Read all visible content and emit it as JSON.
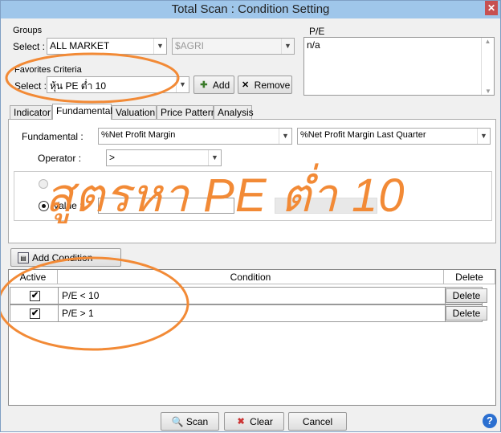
{
  "window": {
    "title": "Total Scan : Condition Setting"
  },
  "groups": {
    "label": "Groups",
    "select_label": "Select :",
    "select_value": "ALL MARKET",
    "secondary_value": "$AGRI"
  },
  "pe_box": {
    "label": "P/E",
    "value": "n/a"
  },
  "favorites": {
    "label": "Favorites Criteria",
    "select_label": "Select :",
    "select_value": "หุ้น PE ต่ำ 10",
    "add_label": "Add",
    "remove_label": "Remove"
  },
  "tabs": [
    {
      "label": "Indicator"
    },
    {
      "label": "Fundamental",
      "active": true
    },
    {
      "label": "Valuation"
    },
    {
      "label": "Price Pattern"
    },
    {
      "label": "Analysis"
    }
  ],
  "fundamental": {
    "label": "Fundamental :",
    "field1": "%Net Profit Margin",
    "field2": "%Net Profit Margin Last Quarter",
    "operator_label": "Operator :",
    "operator_value": ">",
    "value_label": "Value :",
    "value": ""
  },
  "overlay_text": "สูตรหา PE ต่ำ 10",
  "add_condition_label": "Add Condition",
  "grid": {
    "headers": {
      "active": "Active",
      "condition": "Condition",
      "delete": "Delete"
    },
    "rows": [
      {
        "active": true,
        "condition": "P/E < 10",
        "delete_label": "Delete"
      },
      {
        "active": true,
        "condition": "P/E > 1",
        "delete_label": "Delete"
      }
    ]
  },
  "footer": {
    "scan_label": "Scan",
    "clear_label": "Clear",
    "cancel_label": "Cancel"
  },
  "colors": {
    "titlebar": "#9fc6ea",
    "annotation": "#f28a36",
    "close": "#c75050"
  }
}
